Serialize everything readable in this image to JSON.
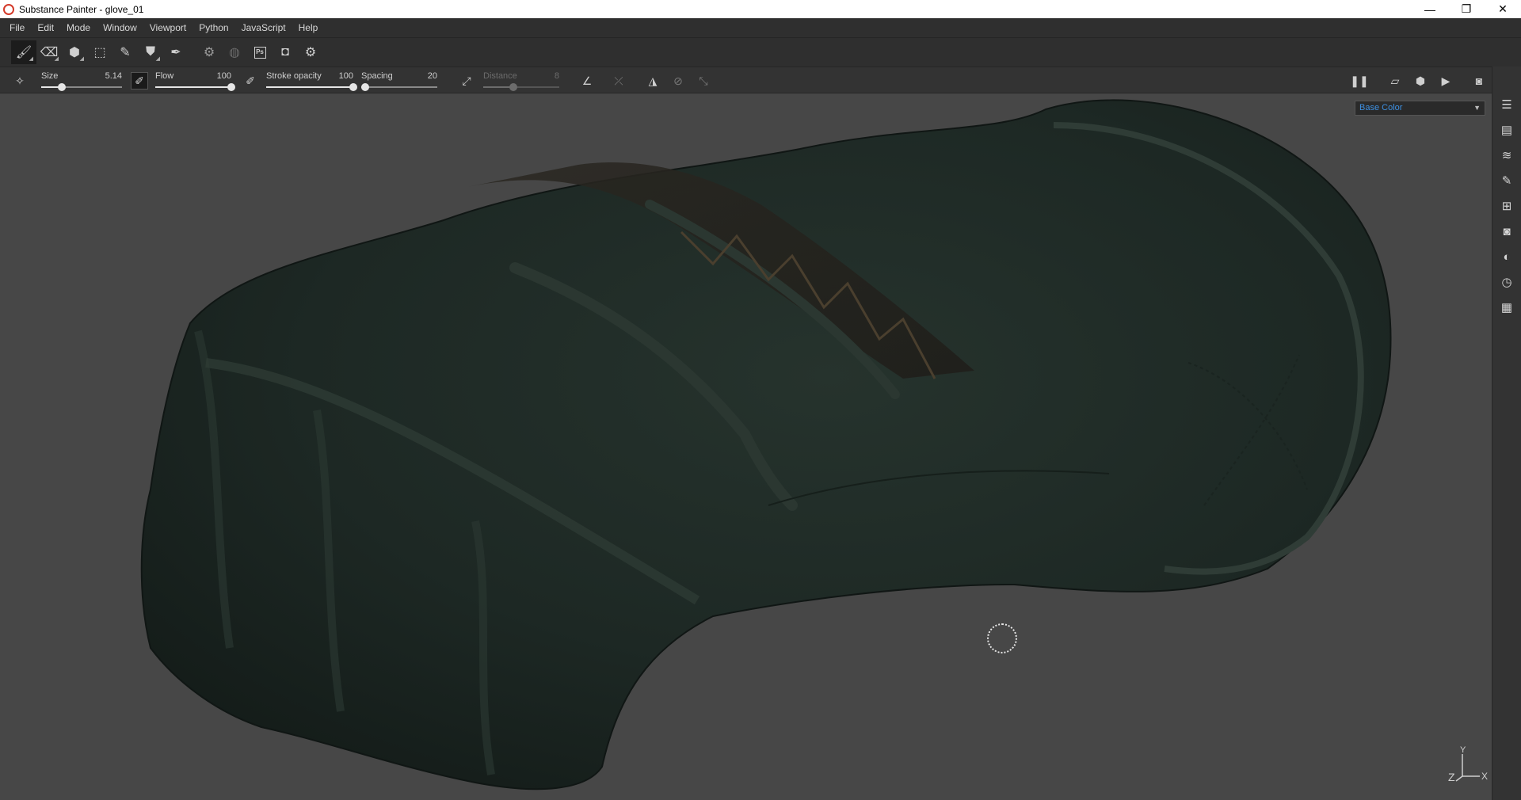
{
  "window": {
    "title": "Substance Painter - glove_01",
    "controls": {
      "minimize": "—",
      "maximize": "❐",
      "close": "✕"
    }
  },
  "menubar": {
    "items": [
      "File",
      "Edit",
      "Mode",
      "Window",
      "Viewport",
      "Python",
      "JavaScript",
      "Help"
    ]
  },
  "toolbar": {
    "tools": [
      {
        "name": "paint-brush-icon",
        "glyph": "🖌",
        "active": true
      },
      {
        "name": "eraser-icon",
        "glyph": "⌫",
        "active": false
      },
      {
        "name": "projection-icon",
        "glyph": "⬢",
        "active": false
      },
      {
        "name": "polygon-fill-icon",
        "glyph": "⬚",
        "active": false
      },
      {
        "name": "smudge-icon",
        "glyph": "✎",
        "active": false
      },
      {
        "name": "clone-stamp-icon",
        "glyph": "⛊",
        "active": false
      },
      {
        "name": "color-picker-icon",
        "glyph": "✒",
        "active": false
      }
    ],
    "extras": [
      {
        "name": "bake-icon",
        "glyph": "⚙"
      },
      {
        "name": "material-icon",
        "glyph": "◍"
      },
      {
        "name": "photoshop-export-icon",
        "glyph": "Ps"
      },
      {
        "name": "render-icon",
        "glyph": "◘"
      },
      {
        "name": "settings-icon",
        "glyph": "⚙"
      }
    ]
  },
  "properties": {
    "size": {
      "label": "Size",
      "value": "5.14",
      "fraction": 0.25
    },
    "flow": {
      "label": "Flow",
      "value": "100",
      "fraction": 1.0
    },
    "stroke_opacity": {
      "label": "Stroke opacity",
      "value": "100",
      "fraction": 1.0
    },
    "spacing": {
      "label": "Spacing",
      "value": "20",
      "fraction": 0.05
    },
    "distance": {
      "label": "Distance",
      "value": "8",
      "fraction": 0.4
    }
  },
  "viewport": {
    "channel": "Base Color",
    "axis": {
      "x": "X",
      "y": "Y",
      "z": "Z"
    }
  },
  "colors": {
    "accent": "#3d8fe0",
    "viewport_bg": "#474747",
    "panel_bg": "#333333",
    "glove_base": "#1c2823"
  }
}
